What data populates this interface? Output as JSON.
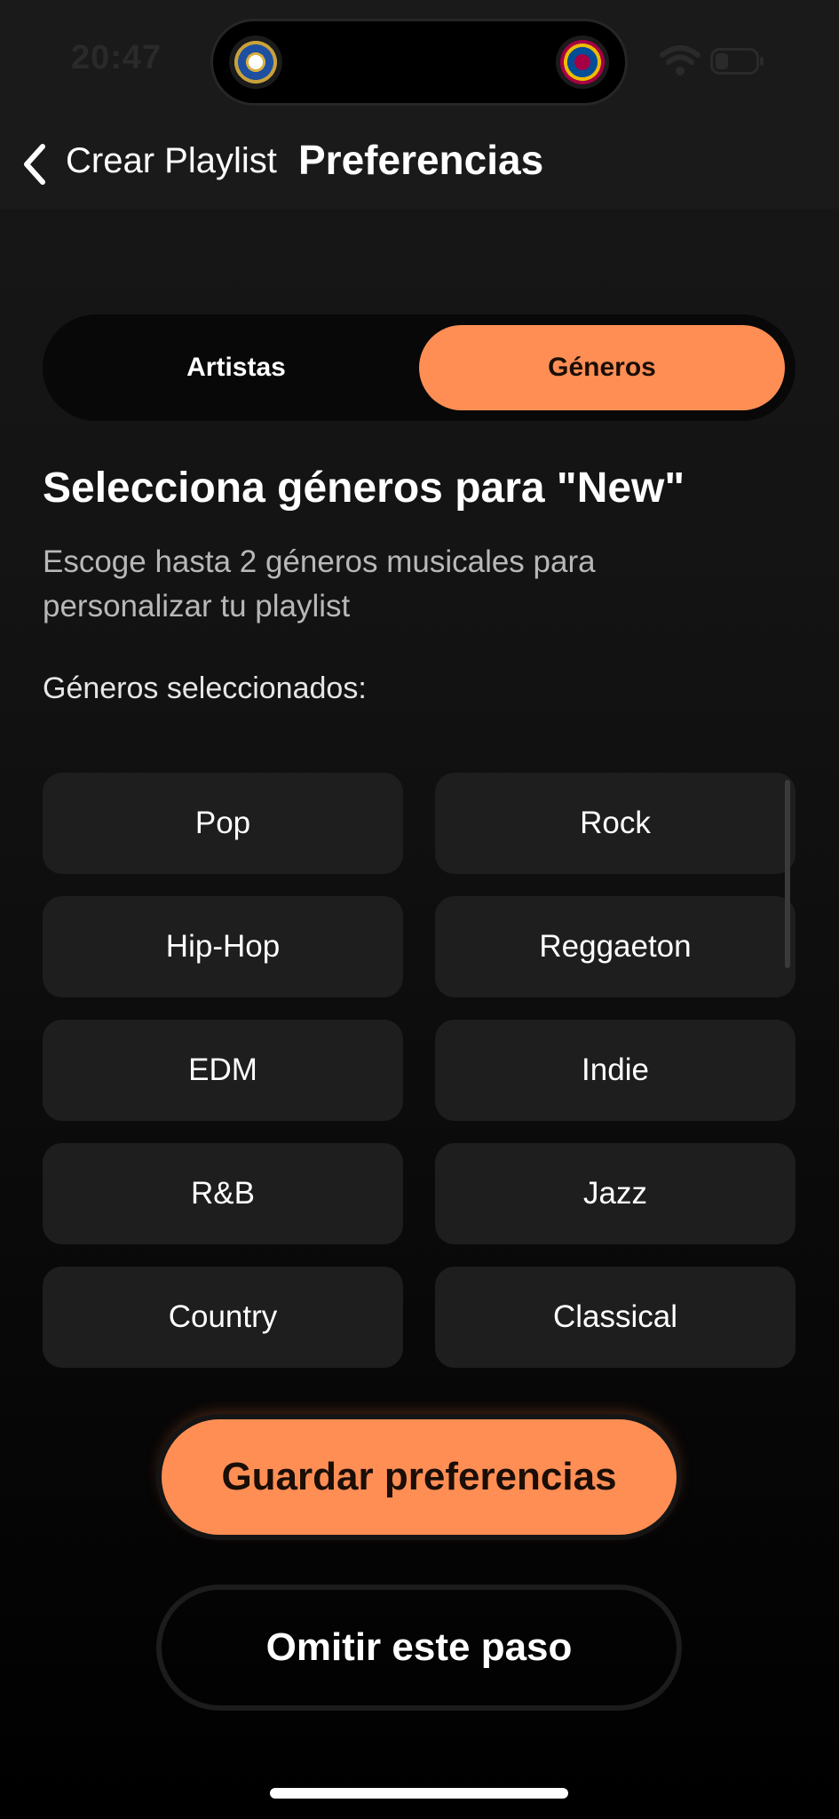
{
  "status_bar": {
    "time": "20:47"
  },
  "header": {
    "back_label": "Crear Playlist",
    "title": "Preferencias"
  },
  "tabs": {
    "artists_label": "Artistas",
    "genres_label": "Géneros",
    "active": "Géneros"
  },
  "content": {
    "title": "Selecciona géneros para \"New\"",
    "subtitle": "Escoge hasta 2 géneros musicales para personalizar tu playlist",
    "selected_label": "Géneros seleccionados:"
  },
  "genres": [
    "Pop",
    "Rock",
    "Hip-Hop",
    "Reggaeton",
    "EDM",
    "Indie",
    "R&B",
    "Jazz",
    "Country",
    "Classical"
  ],
  "actions": {
    "save_label": "Guardar preferencias",
    "skip_label": "Omitir este paso"
  },
  "colors": {
    "accent": "#ff8e55",
    "background": "#141414",
    "chip": "#1e1e1e"
  }
}
